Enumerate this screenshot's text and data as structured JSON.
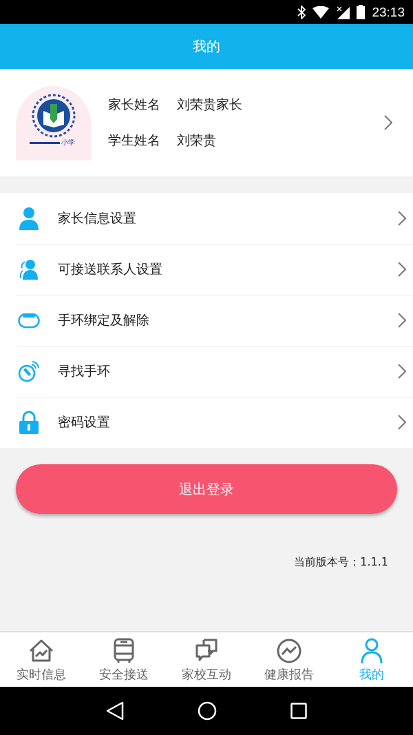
{
  "status_bar": {
    "time": "23:13"
  },
  "header": {
    "title": "我的"
  },
  "profile": {
    "logo_text": "小学",
    "fields": [
      {
        "label": "家长姓名",
        "value": "刘荣贵家长"
      },
      {
        "label": "学生姓名",
        "value": "刘荣贵"
      }
    ]
  },
  "menu": [
    {
      "kind": "person",
      "label": "家长信息设置"
    },
    {
      "kind": "contacts",
      "label": "可接送联系人设置"
    },
    {
      "kind": "band",
      "label": "手环绑定及解除"
    },
    {
      "kind": "find",
      "label": "寻找手环"
    },
    {
      "kind": "lock",
      "label": "密码设置"
    }
  ],
  "logout_button": "退出登录",
  "version": "当前版本号：1.1.1",
  "tab_bar": [
    {
      "kind": "home",
      "label": "实时信息",
      "selected": false
    },
    {
      "kind": "bus",
      "label": "安全接送",
      "selected": false
    },
    {
      "kind": "chat",
      "label": "家校互动",
      "selected": false
    },
    {
      "kind": "trend",
      "label": "健康报告",
      "selected": false
    },
    {
      "kind": "user",
      "label": "我的",
      "selected": true
    }
  ]
}
